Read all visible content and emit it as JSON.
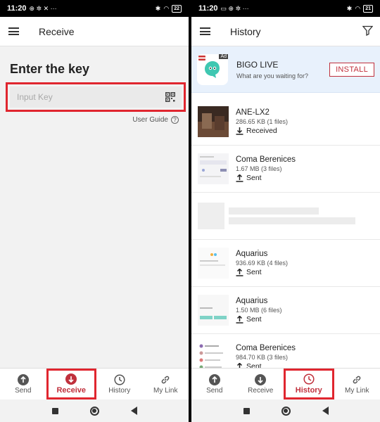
{
  "left": {
    "status": {
      "time": "11:20",
      "battery": "22"
    },
    "appbar": {
      "title": "Receive"
    },
    "enter_key_heading": "Enter the key",
    "key_input_placeholder": "Input Key",
    "user_guide": "User Guide",
    "nav": [
      "Send",
      "Receive",
      "History",
      "My Link"
    ]
  },
  "right": {
    "status": {
      "time": "11:20",
      "battery": "21"
    },
    "appbar": {
      "title": "History"
    },
    "ad": {
      "badge": "Ad",
      "title": "BIGO LIVE",
      "subtitle": "What are you waiting for?",
      "install": "INSTALL"
    },
    "items": [
      {
        "name": "ANE-LX2",
        "size": "286.65 KB (1 files)",
        "status": "Received",
        "thumb": "photo"
      },
      {
        "name": "Coma Berenices",
        "size": "1.67 MB (3 files)",
        "status": "Sent",
        "thumb": "screen"
      },
      {
        "name": "Aquarius",
        "size": "936.69 KB (4 files)",
        "status": "Sent",
        "thumb": "screen2"
      },
      {
        "name": "Aquarius",
        "size": "1.50 MB (6 files)",
        "status": "Sent",
        "thumb": "screen3"
      },
      {
        "name": "Coma Berenices",
        "size": "984.70 KB (3 files)",
        "status": "Sent",
        "thumb": "screen4"
      }
    ],
    "nav": [
      "Send",
      "Receive",
      "History",
      "My Link"
    ]
  },
  "colors": {
    "highlight": "#e0262f",
    "accent": "#c0303c"
  }
}
